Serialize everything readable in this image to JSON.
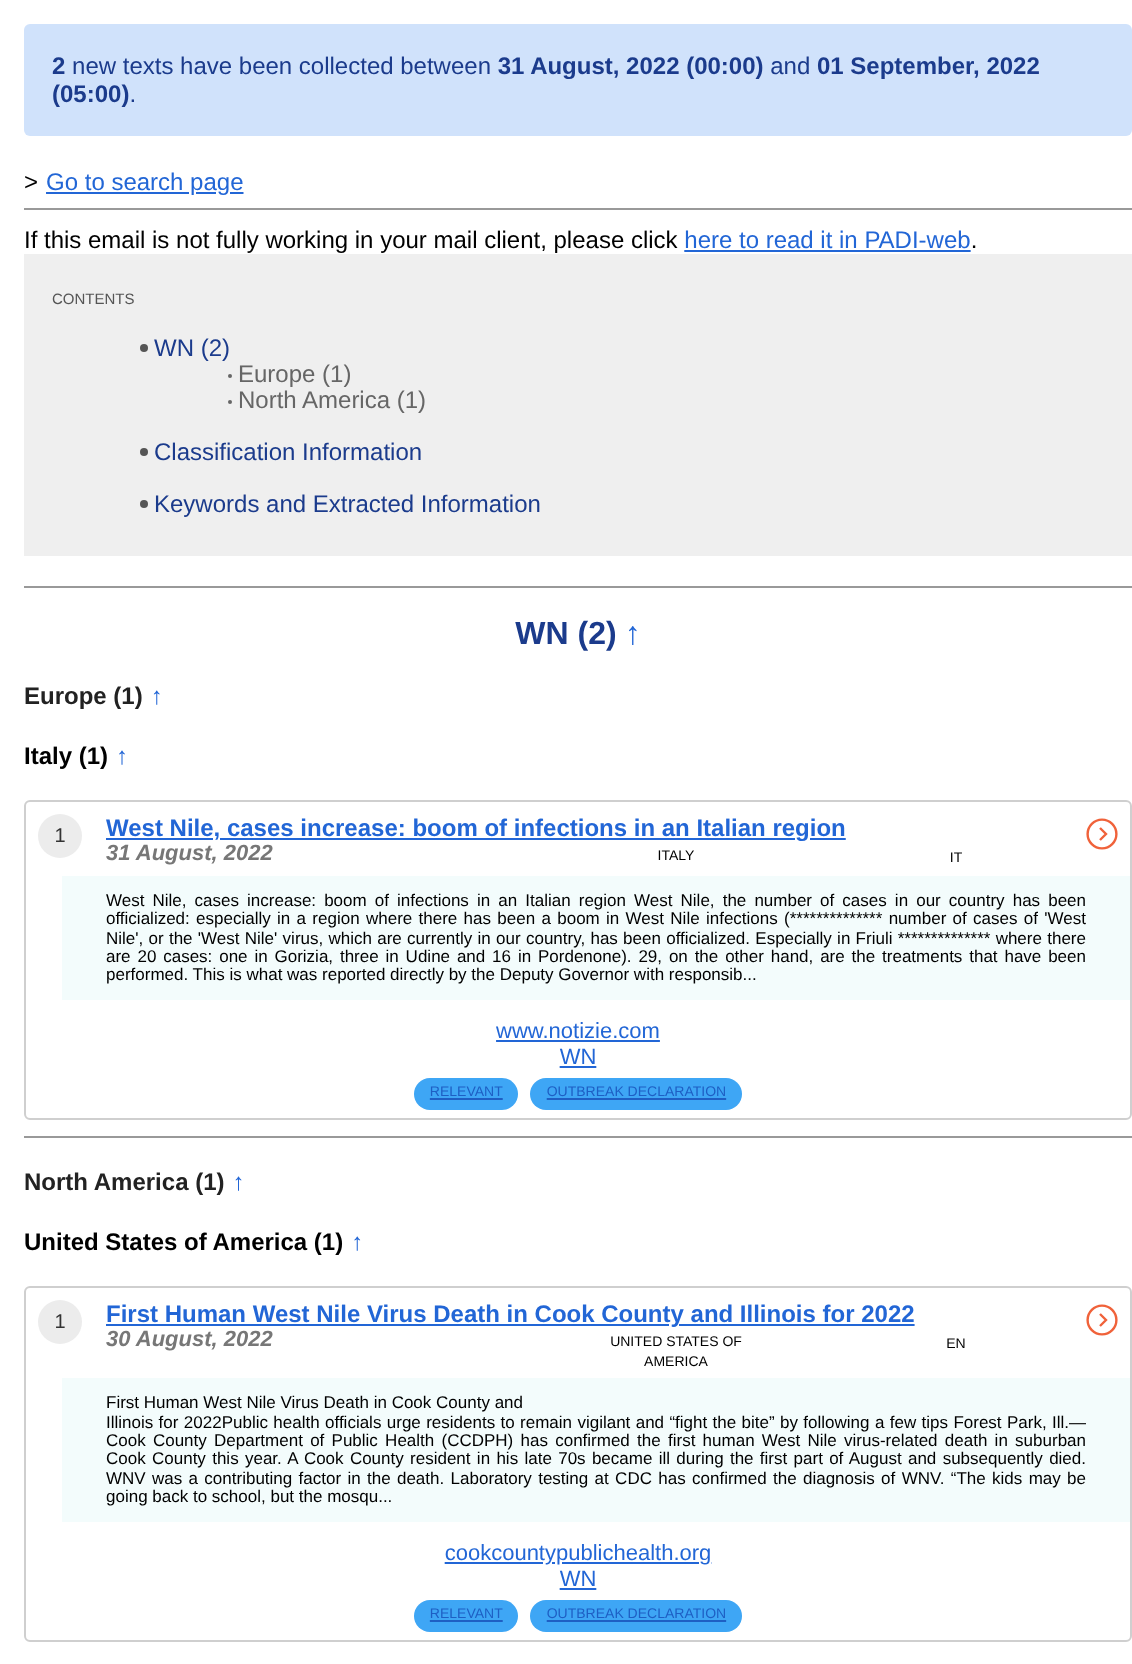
{
  "banner": {
    "text": "**2** new texts have been collected between **31 August, 2022 (00:00)** and **01 September, 2022 (05:00)**."
  },
  "search_link": {
    "prefix": ">",
    "label": "Go to search page"
  },
  "notice": {
    "text": "If this email is not fully working in your mail client, please click",
    "link": "here to read it in PADI-web",
    "suffix": "."
  },
  "contents": {
    "title": "CONTENTS",
    "items": [
      {
        "label": "WN (2)",
        "children": [
          {
            "label": "Europe (1)"
          },
          {
            "label": "North America (1)"
          }
        ]
      },
      {
        "label": "Classification Information"
      },
      {
        "label": "Keywords and Extracted Information"
      }
    ]
  },
  "section": {
    "title": "WN (2)",
    "arrow": "↑"
  },
  "groups": [
    {
      "region": "Europe (1)",
      "region_arrow": "↑",
      "country": "Italy (1)",
      "country_arrow": "↑",
      "articles": [
        {
          "number": "1",
          "title": "West Nile, cases increase: boom of infections in an Italian region",
          "date": "31 August, 2022",
          "country": "ITALY",
          "lang": "IT",
          "summary": "West Nile, cases increase: boom of infections in an Italian region West Nile, the number of cases in our country has been officialized: especially in a region where there has been a boom in West Nile infections (************** number of cases of 'West Nile', or the 'West Nile' virus, which are currently in our country, has been officialized. Especially in Friuli ************** where there are 20 cases: one in Gorizia, three in Udine and 16 in Pordenone). 29, on the other hand, are the treatments that have been performed. This is what was reported directly by the Deputy Governor with responsib...",
          "source": "www.notizie.com",
          "tag": "WN",
          "buttons": [
            "RELEVANT",
            "OUTBREAK DECLARATION"
          ]
        }
      ]
    },
    {
      "region": "North America (1)",
      "region_arrow": "↑",
      "country": "United States of America (1)",
      "country_arrow": "↑",
      "articles": [
        {
          "number": "1",
          "title": "First Human West Nile Virus Death in Cook County and Illinois for 2022",
          "date": "30 August, 2022",
          "country": "UNITED STATES OF AMERICA",
          "lang": "EN",
          "summary": "First Human West Nile Virus Death in Cook County and\nIllinois for 2022Public health officials urge residents to remain vigilant and “fight the bite” by following a few tips  Forest Park, Ill.— Cook County Department of Public Health (CCDPH) has confirmed the first human West Nile virus-related death in suburban Cook County this year. A Cook County resident in his late 70s became ill during the first part of August and subsequently died. WNV was a contributing factor in the death. Laboratory testing at CDC has confirmed the diagnosis of WNV. “The kids may be going back to school, but the mosqu...",
          "source": "cookcountypublichealth.org",
          "tag": "WN",
          "buttons": [
            "RELEVANT",
            "OUTBREAK DECLARATION"
          ]
        }
      ]
    }
  ]
}
